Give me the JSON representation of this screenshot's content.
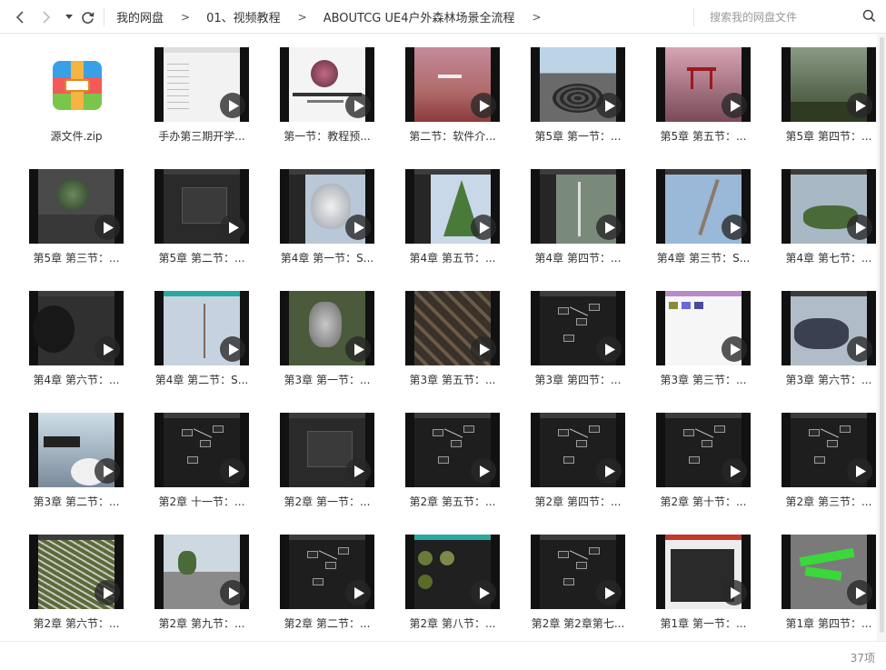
{
  "nav": {
    "back_icon": "chevron-left-icon",
    "forward_icon": "chevron-right-icon",
    "dropdown_icon": "caret-down-icon",
    "refresh_icon": "refresh-icon"
  },
  "breadcrumb": [
    "我的网盘",
    "01、视频教程",
    "ABOUTCG UE4户外森林场景全流程"
  ],
  "breadcrumb_separator": ">",
  "search": {
    "placeholder": "搜索我的网盘文件",
    "icon": "search-icon"
  },
  "files": [
    {
      "name": "源文件.zip",
      "type": "zip"
    },
    {
      "name": "手办第三期开学...",
      "type": "video",
      "theme": "light"
    },
    {
      "name": "第一节：教程预...",
      "type": "video",
      "theme": "title"
    },
    {
      "name": "第二节：软件介...",
      "type": "video",
      "theme": "desktop"
    },
    {
      "name": "第5章 第一节：...",
      "type": "video",
      "theme": "ripple"
    },
    {
      "name": "第5章 第五节：...",
      "type": "video",
      "theme": "torii"
    },
    {
      "name": "第5章 第四节：...",
      "type": "video",
      "theme": "forest"
    },
    {
      "name": "第5章 第三节：...",
      "type": "video",
      "theme": "sphere"
    },
    {
      "name": "第5章 第二节：...",
      "type": "video",
      "theme": "dark"
    },
    {
      "name": "第4章 第一节：S...",
      "type": "video",
      "theme": "tree"
    },
    {
      "name": "第4章 第五节：...",
      "type": "video",
      "theme": "pine"
    },
    {
      "name": "第4章 第四节：...",
      "type": "video",
      "theme": "trunk"
    },
    {
      "name": "第4章 第三节：S...",
      "type": "video",
      "theme": "branch"
    },
    {
      "name": "第4章 第七节：...",
      "type": "video",
      "theme": "grass"
    },
    {
      "name": "第4章 第六节：...",
      "type": "video",
      "theme": "ball"
    },
    {
      "name": "第4章 第二节：S...",
      "type": "video",
      "theme": "sapling"
    },
    {
      "name": "第3章 第一节：...",
      "type": "video",
      "theme": "statue"
    },
    {
      "name": "第3章 第五节：...",
      "type": "video",
      "theme": "rocks"
    },
    {
      "name": "第3章 第四节：...",
      "type": "video",
      "theme": "nodes"
    },
    {
      "name": "第3章 第三节：...",
      "type": "video",
      "theme": "swatches"
    },
    {
      "name": "第3章 第六节：...",
      "type": "video",
      "theme": "plant"
    },
    {
      "name": "第3章 第二节：...",
      "type": "video",
      "theme": "capture"
    },
    {
      "name": "第2章 十一节：...",
      "type": "video",
      "theme": "nodes"
    },
    {
      "name": "第2章 第一节：...",
      "type": "video",
      "theme": "dark"
    },
    {
      "name": "第2章 第五节：...",
      "type": "video",
      "theme": "nodes"
    },
    {
      "name": "第2章 第四节：...",
      "type": "video",
      "theme": "nodes"
    },
    {
      "name": "第2章 第十节：...",
      "type": "video",
      "theme": "nodes"
    },
    {
      "name": "第2章 第三节：...",
      "type": "video",
      "theme": "nodes"
    },
    {
      "name": "第2章 第六节：...",
      "type": "video",
      "theme": "moss"
    },
    {
      "name": "第2章 第九节：...",
      "type": "video",
      "theme": "street"
    },
    {
      "name": "第2章 第二节：...",
      "type": "video",
      "theme": "nodes"
    },
    {
      "name": "第2章 第八节：...",
      "type": "video",
      "theme": "spheres"
    },
    {
      "name": "第2章 第2章第七...",
      "type": "video",
      "theme": "nodes"
    },
    {
      "name": "第1章 第一节：...",
      "type": "video",
      "theme": "doc"
    },
    {
      "name": "第1章 第四节：...",
      "type": "video",
      "theme": "path"
    }
  ],
  "footer": {
    "count": "37项"
  }
}
